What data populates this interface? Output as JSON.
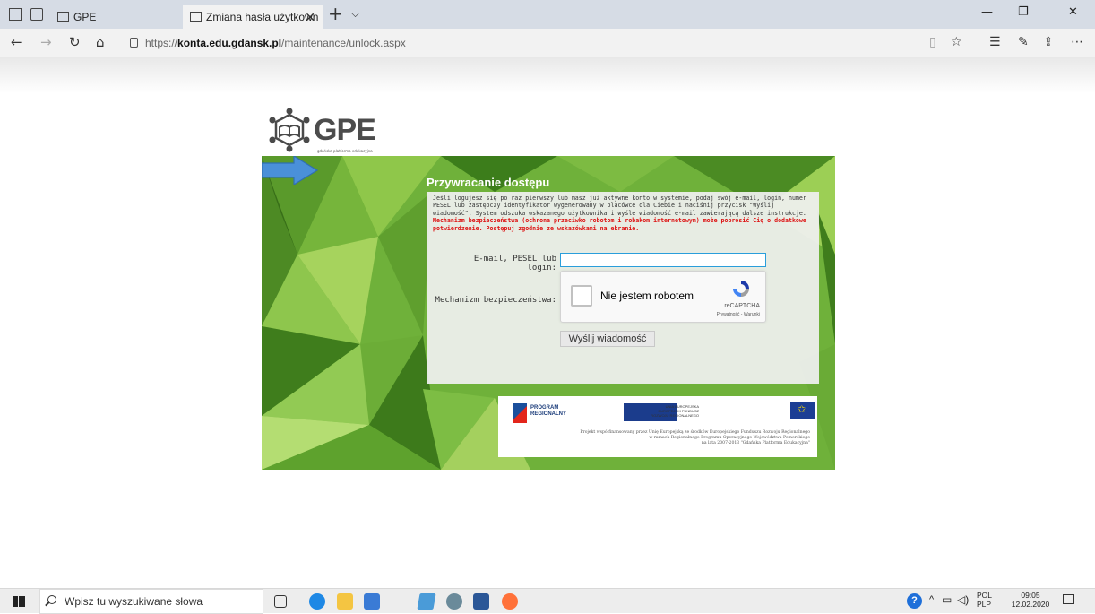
{
  "browser": {
    "tabs": [
      {
        "label": "GPE"
      },
      {
        "label": "Zmiana hasła użytkown"
      }
    ],
    "url_prefix": "https://",
    "url_host": "konta.edu.gdansk.pl",
    "url_path": "/maintenance/unlock.aspx"
  },
  "logo": {
    "text": "GPE",
    "subtitle": "gdańska platforma edukacyjna"
  },
  "form": {
    "title": "Przywracanie dostępu",
    "instructions": "Jeśli logujesz się po raz pierwszy lub masz już aktywne konto w systemie, podaj swój e-mail, login, numer PESEL lub zastępczy identyfikator wygenerowany w placówce dla Ciebie i naciśnij przycisk \"Wyślij wiadomość\". System odszuka wskazanego użytkownika i wyśle wiadomość e-mail zawierającą dalsze instrukcje.",
    "warning": "Mechanizm bezpieczeństwa (ochrona przeciwko robotom i robakom internetowym) może poprosić Cię o dodatkowe potwierdzenie. Postępuj zgodnie ze wskazówkami na ekranie.",
    "email_label": "E-mail, PESEL lub login:",
    "email_value": "",
    "security_label": "Mechanizm bezpieczeństwa:",
    "send_label": "Wyślij wiadomość"
  },
  "recaptcha": {
    "label": "Nie jestem robotem",
    "brand": "reCAPTCHA",
    "terms": "Prywatność - Warunki"
  },
  "eu": {
    "program_l1": "PROGRAM",
    "program_l2": "REGIONALNY",
    "ue_l1": "UNIA EUROPEJSKA",
    "ue_l2": "EUROPEJSKI FUNDUSZ",
    "ue_l3": "ROZWOJU REGIONALNEGO",
    "project_l1": "Projekt współfinansowany przez Unię Europejską ze środków Europejskiego Funduszu Rozwoju Regionalnego",
    "project_l2": "w ramach Regionalnego Programu Operacyjnego Województwa Pomorskiego",
    "project_l3": "na lata 2007-2013 \"Gdańska Platforma Edukacyjna\""
  },
  "taskbar": {
    "search_placeholder": "Wpisz tu wyszukiwane słowa",
    "lang_top": "POL",
    "lang_bottom": "PLP",
    "time": "09:05",
    "date": "12.02.2020"
  }
}
